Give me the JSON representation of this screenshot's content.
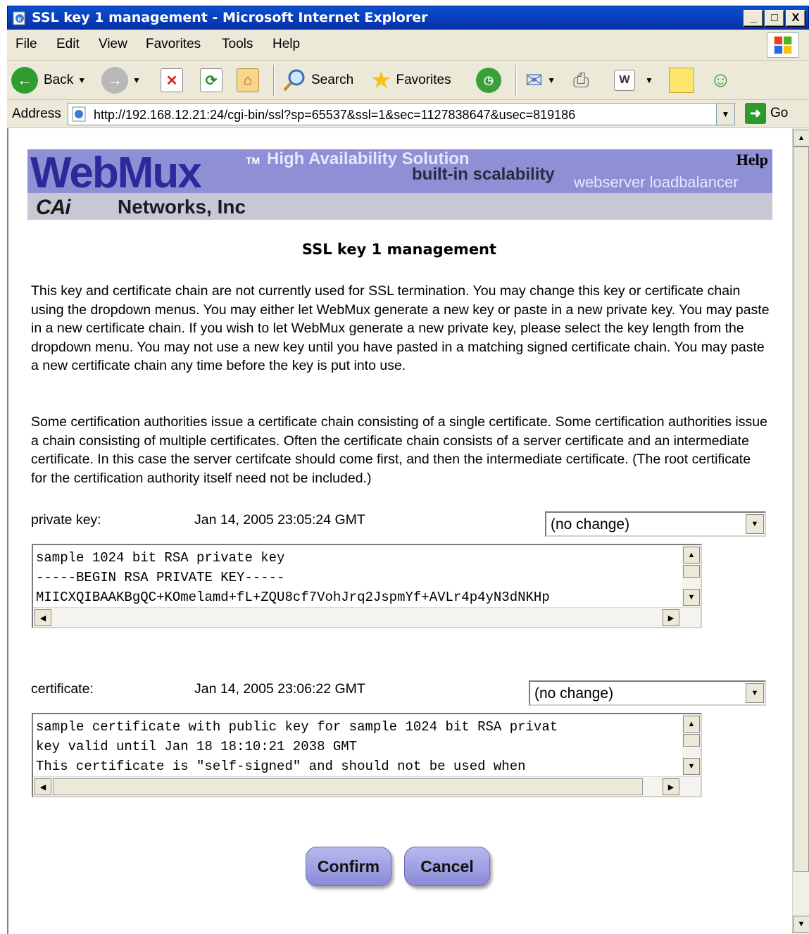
{
  "window": {
    "title": "SSL key 1 management - Microsoft Internet Explorer",
    "minimize": "_",
    "maximize": "□",
    "close": "X"
  },
  "menu": [
    "File",
    "Edit",
    "View",
    "Favorites",
    "Tools",
    "Help"
  ],
  "toolbar": {
    "back": "Back",
    "search": "Search",
    "favorites": "Favorites"
  },
  "address": {
    "label": "Address",
    "url": "http://192.168.12.21:24/cgi-bin/ssl?sp=65537&ssl=1&sec=1127838647&usec=819186",
    "go": "Go"
  },
  "banner": {
    "logo": "WebMux",
    "tm": "TM",
    "tagline1": "High Availability Solution",
    "tagline2": "built-in scalability",
    "tagline3": "webserver loadbalancer",
    "help": "Help",
    "company_logo": "CAi",
    "company": "Networks, Inc"
  },
  "page": {
    "title": "SSL key 1 management",
    "paragraph1": "This key and certificate chain are not currently used for SSL termination. You may change this key or certificate chain using the dropdown menus. You may either let WebMux generate a new key or paste in a new private key. You may paste in a new certificate chain. If you wish to let WebMux generate a new private key, please select the key length from the dropdown menu. You may not use a new key until you have pasted in a matching signed certificate chain. You may paste a new certificate chain any time before the key is put into use.",
    "paragraph2": "Some certification authorities issue a certificate chain consisting of a single certificate. Some certification authorities issue a chain consisting of multiple certificates. Often the certificate chain consists of a server certificate and an intermediate certificate. In this case the server certifcate should come first, and then the intermediate certificate. (The root certificate for the certification authority itself need not be included.)"
  },
  "private_key": {
    "label": "private key:",
    "date": "Jan 14, 2005 23:05:24 GMT",
    "select": "(no change)",
    "content": "sample 1024 bit RSA private key\n-----BEGIN RSA PRIVATE KEY-----\nMIICXQIBAAKBgQC+KOmelamd+fL+ZQU8cf7VohJrq2JspmYf+AVLr4p4yN3dNKHp"
  },
  "certificate": {
    "label": "certificate:",
    "date": "Jan 14, 2005 23:06:22 GMT",
    "select": "(no change)",
    "content": "sample certificate with public key for sample 1024 bit RSA privat\nkey valid until Jan 18 18:10:21 2038 GMT\nThis certificate is \"self-signed\" and should not be used when"
  },
  "buttons": {
    "confirm": "Confirm",
    "cancel": "Cancel"
  }
}
